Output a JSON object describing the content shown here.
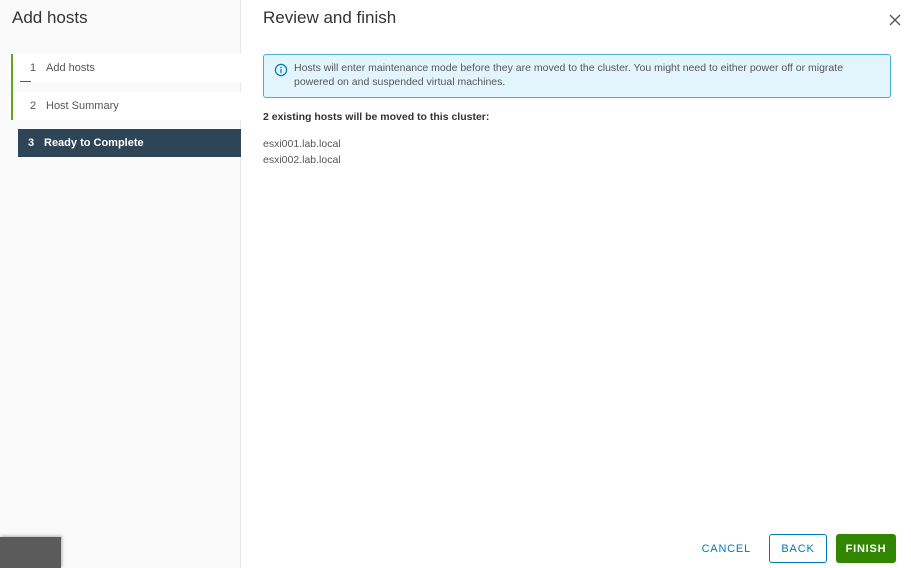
{
  "sidebar": {
    "title": "Add hosts",
    "steps": [
      {
        "number": "1",
        "label": "Add hosts",
        "state": "done"
      },
      {
        "number": "2",
        "label": "Host Summary",
        "state": "done"
      },
      {
        "number": "3",
        "label": "Ready to Complete",
        "state": "current"
      }
    ]
  },
  "main": {
    "title": "Review and finish",
    "close_icon": "close-icon",
    "alert": {
      "icon": "info-icon",
      "text": "Hosts will enter maintenance mode before they are moved to the cluster. You might need to either power off or migrate powered on and suspended virtual machines."
    },
    "summary": "2 existing hosts will be moved to this cluster:",
    "hosts": [
      "esxi001.lab.local",
      "esxi002.lab.local"
    ]
  },
  "footer": {
    "cancel_label": "CANCEL",
    "back_label": "BACK",
    "finish_label": "FINISH"
  },
  "colors": {
    "accent": "#0079b8",
    "success": "#318700",
    "step_done_bar": "#62a420",
    "current_step_bg": "#2e4558",
    "alert_bg": "#e3f5fc",
    "alert_border": "#49afd9"
  }
}
